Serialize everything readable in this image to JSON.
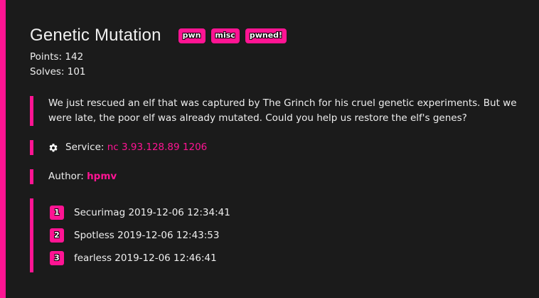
{
  "challenge": {
    "title": "Genetic Mutation",
    "tags": [
      "pwn",
      "misc",
      "pwned!"
    ],
    "points_label": "Points: 142",
    "solves_label": "Solves: 101",
    "description": "We just rescued an elf that was captured by The Grinch for his cruel genetic experiments. But we were late, the poor elf was already mutated. Could you help us restore the elf's genes?",
    "service_label": "Service:",
    "service_value": "nc 3.93.128.89 1206",
    "author_label": "Author:",
    "author_value": "hpmv"
  },
  "solves": [
    {
      "rank": "1",
      "text": "Securimag 2019-12-06 12:34:41"
    },
    {
      "rank": "2",
      "text": "Spotless 2019-12-06 12:43:53"
    },
    {
      "rank": "3",
      "text": "fearless 2019-12-06 12:46:41"
    }
  ],
  "colors": {
    "accent": "#ff1493",
    "background": "#1b1b1b",
    "text": "#eeeeee"
  },
  "icons": {
    "service": "gear-icon"
  }
}
